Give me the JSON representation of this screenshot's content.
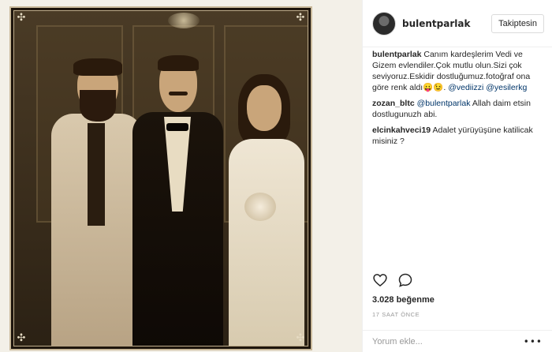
{
  "post": {
    "author": "bulentparlak",
    "follow_label": "Takiptesin",
    "caption": {
      "user": "bulentparlak",
      "text": "Canım kardeşlerim Vedi ve Gizem evlendiler.Çok mutlu olun.Sizi çok seviyoruz.Eskidir dostluğumuz.fotoğraf ona göre renk aldı😛😉.",
      "mention1": "@vediizzi",
      "mention2": "@yesilerkg"
    },
    "comments": [
      {
        "user": "zozan_bltc",
        "mention": "@bulentparlak",
        "text": "Allah daim etsin dostlugunuzh abi."
      },
      {
        "user": "elcinkahveci19",
        "mention": "",
        "text": "Adalet yürüyüşüne katilicak misiniz ?"
      }
    ],
    "likes": "3.028 beğenme",
    "time": "17 SAAT ÖNCE",
    "comment_placeholder": "Yorum ekle...",
    "more": "•••"
  },
  "icons": {
    "like": "heart-icon",
    "comment": "comment-icon",
    "more": "more-dots-icon"
  },
  "colors": {
    "mention": "#003569",
    "photo_tint": "#3a2d1c"
  }
}
